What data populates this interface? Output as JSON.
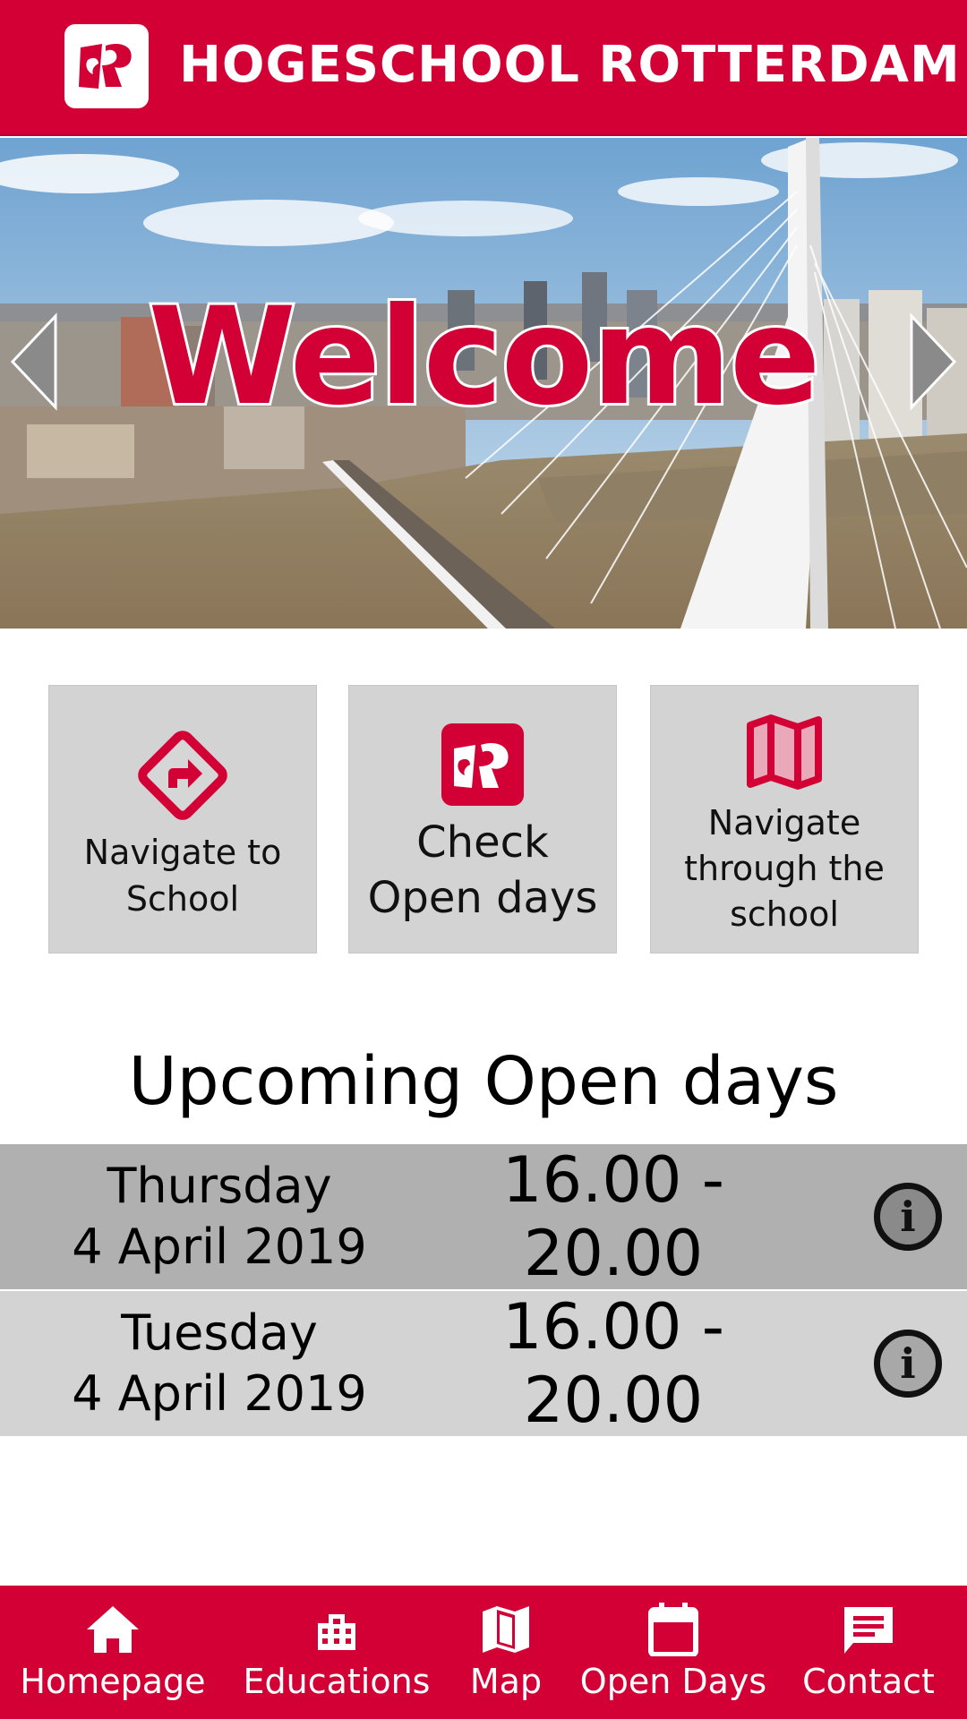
{
  "header": {
    "brand": "HOGESCHOOL ROTTERDAM",
    "logo_icon": "hr-logo-icon"
  },
  "hero": {
    "title": "Welcome",
    "prev_icon": "chevron-left-icon",
    "next_icon": "chevron-right-icon"
  },
  "tiles": [
    {
      "label_line1": "Navigate to",
      "label_line2": "School",
      "label_line3": "",
      "icon": "directions-icon"
    },
    {
      "label_line1": "Check",
      "label_line2": "Open days",
      "label_line3": "",
      "icon": "hr-logo-icon"
    },
    {
      "label_line1": "Navigate",
      "label_line2": "through the",
      "label_line3": "school",
      "icon": "map-icon"
    }
  ],
  "upcoming": {
    "title": "Upcoming Open days",
    "rows": [
      {
        "day": "Thursday",
        "date": "4 April 2019",
        "time": "16.00 - 20.00",
        "icon": "info-icon"
      },
      {
        "day": "Tuesday",
        "date": "4 April 2019",
        "time": "16.00 - 20.00",
        "icon": "info-icon"
      }
    ]
  },
  "nav": {
    "items": [
      {
        "label": "Homepage",
        "icon": "home-icon"
      },
      {
        "label": "Educations",
        "icon": "building-icon"
      },
      {
        "label": "Map",
        "icon": "map-icon"
      },
      {
        "label": "Open Days",
        "icon": "calendar-icon"
      },
      {
        "label": "Contact",
        "icon": "chat-icon"
      }
    ]
  },
  "colors": {
    "brand_red": "#d20034",
    "tile_gray": "#d3d3d3",
    "row_dark": "#b0b0b0",
    "row_light": "#d3d3d3"
  }
}
